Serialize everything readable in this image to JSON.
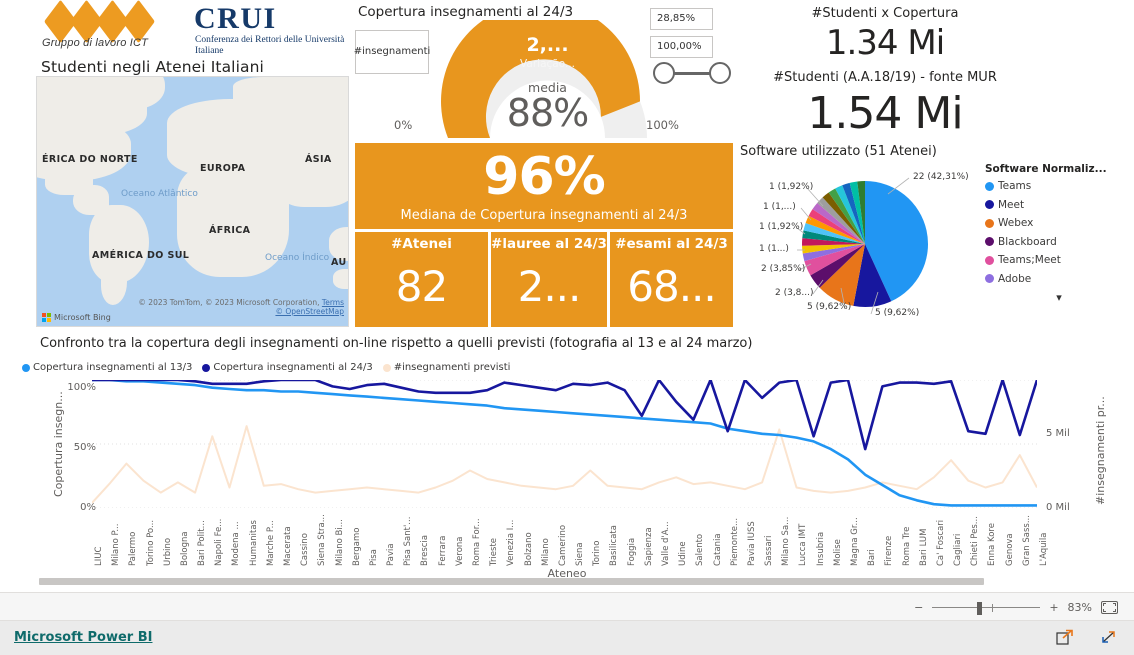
{
  "branding": {
    "logo_caption": "Gruppo di lavoro ICT",
    "crui_acronym": "CRUI",
    "crui_full": "Conferenza dei Rettori delle Università Italiane",
    "page_title": "Studenti negli Atenei Italiani",
    "accent_orange": "#E8961E",
    "brand_blue": "#163A69"
  },
  "map": {
    "labels": [
      "ÉRICA DO NORTE",
      "EUROPA",
      "ÁSIA",
      "ÁFRICA",
      "AMÉRICA DO SUL",
      "AU"
    ],
    "ocean_atlantic": "Oceano Atlântico",
    "ocean_indian": "Oceano Índico",
    "attribution": "© 2023 TomTom, © 2023 Microsoft Corporation,",
    "terms": "Terms",
    "osm": "© OpenStreetMap",
    "provider": "Microsoft Bing"
  },
  "gauge": {
    "title": "Copertura insegnamenti al 24/3",
    "slicer_label": "#insegnamenti",
    "min_label": "0%",
    "max_label": "100%",
    "value_caption": "media",
    "value": "88%",
    "target_label": "2,...",
    "target_sub": "Variação...",
    "percent_filled": 88,
    "range_min": "28,85%",
    "range_max": "100,00%"
  },
  "kpis": {
    "median": {
      "value": "96%",
      "label": "Mediana de Copertura insegnamenti al 24/3"
    },
    "cards": [
      {
        "label": "#Atenei",
        "value": "82"
      },
      {
        "label": "#lauree al 24/3",
        "value": "2..."
      },
      {
        "label": "#esami al 24/3",
        "value": "68..."
      }
    ]
  },
  "students": {
    "coverage_label": "#Studenti x Copertura",
    "coverage_value": "1.34 Mi",
    "total_label": "#Studenti (A.A.18/19) - fonte MUR",
    "total_value": "1.54 Mi"
  },
  "pie": {
    "title": "Software utilizzato (51 Atenei)",
    "legend_title": "Software Normaliz...",
    "labels": [
      "22 (42,31%)",
      "5 (9,62%)",
      "5 (9,62%)",
      "2 (3,8...)",
      "2 (3,85%)",
      "1 (1...)",
      "1 (1,92%)",
      "1 (1,...)",
      "1 (1,92%)"
    ],
    "legend": [
      {
        "name": "Teams",
        "color": "#2196F3"
      },
      {
        "name": "Meet",
        "color": "#17179E"
      },
      {
        "name": "Webex",
        "color": "#E8751A"
      },
      {
        "name": "Blackboard",
        "color": "#5C0E6B"
      },
      {
        "name": "Teams;Meet",
        "color": "#E0509E"
      },
      {
        "name": "Adobe",
        "color": "#8E6FE0"
      }
    ]
  },
  "chart_data": {
    "type": "line",
    "title": "Confronto tra la copertura degli insegnamenti on-line rispetto a quelli previsti (fotografia al 13 e al 24 marzo)",
    "xlabel": "Ateneo",
    "ylabel": "Copertura insegn...",
    "y2label": "#insegnamenti pr...",
    "ylim": [
      0,
      100
    ],
    "y2lim": [
      0,
      7500
    ],
    "yticks": [
      "0%",
      "50%",
      "100%"
    ],
    "y2ticks": [
      "0 Mil",
      "5 Mil"
    ],
    "grid": true,
    "legend_position": "top-left",
    "categories": [
      "LIUC",
      "Milano P...",
      "Palermo",
      "Torino Po...",
      "Urbino",
      "Bologna",
      "Bari Polit...",
      "Napoli Fe...",
      "Modena ...",
      "Humanitas",
      "Marche P...",
      "Macerata",
      "Cassino",
      "Siena Stra...",
      "Milano Bi...",
      "Bergamo",
      "Pisa",
      "Pavia",
      "Pisa Sant'...",
      "Brescia",
      "Ferrara",
      "Verona",
      "Roma For...",
      "Trieste",
      "Venezia I...",
      "Bolzano",
      "Milano",
      "Camerino",
      "Siena",
      "Torino",
      "Basilicata",
      "Foggia",
      "Sapienza",
      "Valle d'A...",
      "Udine",
      "Salento",
      "Catania",
      "Piemonte...",
      "Pavia IUSS",
      "Sassari",
      "Milano Sa...",
      "Lucca IMT",
      "Insubria",
      "Molise",
      "Magna Gr...",
      "Bari",
      "Firenze",
      "Roma Tre",
      "Bari LUM",
      "Ca' Foscari",
      "Cagliari",
      "Chieti Pes...",
      "Enna Kore",
      "Genova",
      "Gran Sass...",
      "L'Aquila"
    ],
    "series": [
      {
        "name": "Copertura insegnamenti al 13/3",
        "color": "#2196F3",
        "axis": "left",
        "values": [
          100,
          100,
          99,
          99,
          98,
          97,
          96,
          94,
          93,
          92,
          92,
          91,
          91,
          90,
          89,
          88,
          87,
          86,
          85,
          84,
          83,
          82,
          81,
          80,
          78,
          77,
          76,
          75,
          74,
          73,
          72,
          71,
          70,
          69,
          68,
          67,
          66,
          62,
          60,
          58,
          57,
          55,
          52,
          46,
          38,
          26,
          18,
          10,
          6,
          3,
          2,
          2,
          2,
          2,
          2,
          2
        ]
      },
      {
        "name": "Copertura insegnamenti al 24/3",
        "color": "#17179E",
        "axis": "left",
        "values": [
          100,
          100,
          100,
          100,
          100,
          100,
          99,
          97,
          97,
          97,
          99,
          100,
          100,
          100,
          95,
          93,
          96,
          97,
          94,
          91,
          90,
          90,
          90,
          92,
          98,
          96,
          94,
          92,
          97,
          96,
          98,
          92,
          72,
          100,
          83,
          69,
          100,
          60,
          100,
          86,
          98,
          100,
          56,
          98,
          100,
          46,
          95,
          98,
          98,
          97,
          99,
          60,
          58,
          100,
          57,
          100
        ]
      },
      {
        "name": "#insegnamenti previsti",
        "color": "#FBE4CF",
        "axis": "right",
        "values": [
          300,
          1400,
          2600,
          1600,
          900,
          1500,
          900,
          4200,
          1200,
          4800,
          1300,
          1400,
          1100,
          900,
          1000,
          1100,
          1200,
          1100,
          1000,
          900,
          1200,
          1600,
          2200,
          1700,
          1500,
          1300,
          1200,
          1100,
          1300,
          2200,
          1300,
          1200,
          1100,
          1500,
          1800,
          1400,
          1500,
          1300,
          1100,
          1500,
          4600,
          1200,
          1000,
          900,
          1000,
          1200,
          1500,
          1300,
          1100,
          1800,
          2800,
          1600,
          1200,
          1500,
          3100,
          1200
        ]
      }
    ]
  },
  "statusbar": {
    "zoom_level": "83%",
    "minus": "−",
    "plus": "+"
  },
  "footer": {
    "link": "Microsoft Power BI"
  }
}
